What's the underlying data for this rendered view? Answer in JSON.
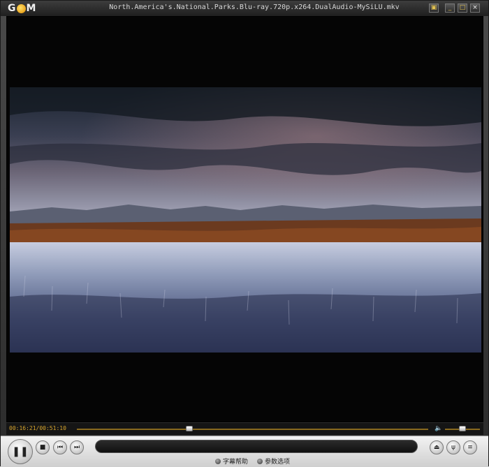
{
  "app": {
    "logo": "G",
    "logo_tail": "M",
    "title": "North.America's.National.Parks.Blu-ray.720p.x264.DualAudio-MySiLU.mkv"
  },
  "window_buttons": {
    "settings": "▣",
    "minimize": "_",
    "maximize": "□",
    "close": "×"
  },
  "playback": {
    "current_time": "00:16:21",
    "separator": "/",
    "total_time": "00:51:10",
    "progress_fraction": 0.32,
    "volume_fraction": 0.5
  },
  "controls": {
    "pause": "❚❚",
    "stop": "■",
    "prev": "⏮",
    "next": "⏭",
    "eject": "⏏",
    "equalizer": "ψ",
    "menu": "≡"
  },
  "links": {
    "subtitle_help": "字幕帮助",
    "preferences": "参数选项"
  },
  "icons": {
    "volume": "🔈"
  }
}
